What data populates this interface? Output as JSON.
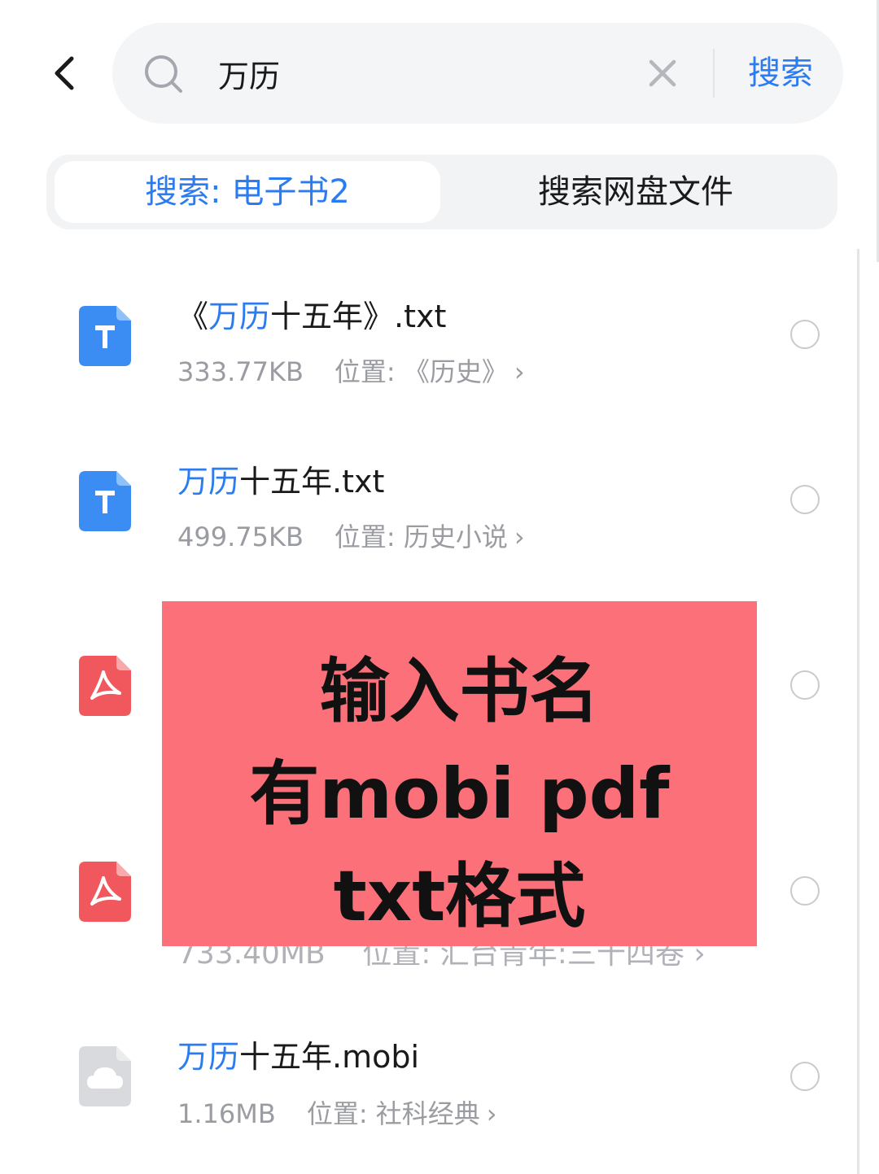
{
  "search": {
    "query": "万历",
    "button_label": "搜索"
  },
  "tabs": [
    {
      "label": "搜索: 电子书2"
    },
    {
      "label": "搜索网盘文件"
    }
  ],
  "files": [
    {
      "title_prefix": "《",
      "title_hl": "万历",
      "title_rest": "十五年》.txt",
      "size": "333.77KB",
      "location_label": "位置:",
      "location": "《历史》",
      "icon": "txt-file-icon"
    },
    {
      "title_prefix": "",
      "title_hl": "万历",
      "title_rest": "十五年.txt",
      "size": "499.75KB",
      "location_label": "位置:",
      "location": "历史小说",
      "icon": "txt-file-icon"
    },
    {
      "icon": "pdf-file-icon"
    },
    {
      "icon": "pdf-file-icon",
      "size": "733.40MB",
      "location_label": "位置:",
      "location": "汇台青年:三十四卷"
    },
    {
      "title_prefix": "",
      "title_hl": "万历",
      "title_rest": "十五年.mobi",
      "size": "1.16MB",
      "location_label": "位置:",
      "location": "社科经典",
      "icon": "cloud-file-icon"
    }
  ],
  "banner": {
    "line1": "输入书名",
    "line2": "有mobi pdf",
    "line3": "txt格式",
    "color": "#fb7079"
  },
  "colors": {
    "accent": "#2b7cf0",
    "muted": "#9a9ca2",
    "txt_icon": "#3b8cf3",
    "pdf_icon": "#f0585d",
    "cloud_icon": "#d9dadd"
  }
}
